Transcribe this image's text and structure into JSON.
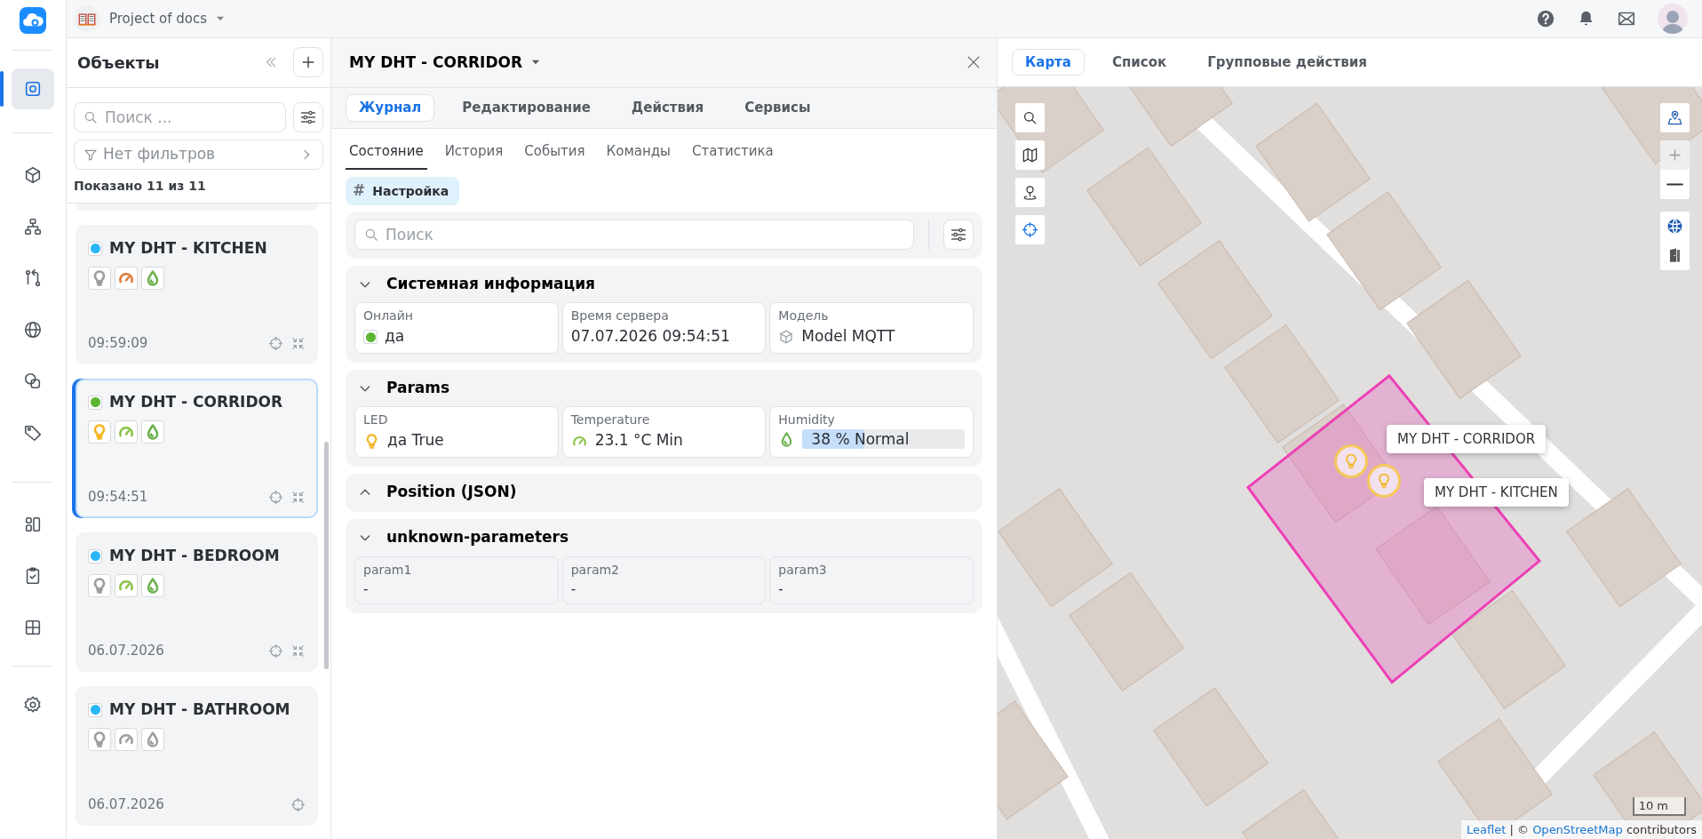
{
  "rail": {
    "groups": [
      [
        {
          "kind": "objects",
          "selected": true
        }
      ],
      [
        {
          "kind": "cube",
          "selected": false
        },
        {
          "kind": "hierarchy",
          "selected": false
        },
        {
          "kind": "compare",
          "selected": false
        },
        {
          "kind": "globe",
          "selected": false
        },
        {
          "kind": "shapes",
          "selected": false
        },
        {
          "kind": "tag",
          "selected": false
        }
      ],
      [
        {
          "kind": "dashboard",
          "selected": false
        },
        {
          "kind": "clipboard",
          "selected": false
        },
        {
          "kind": "grid",
          "selected": false
        }
      ],
      [
        {
          "kind": "gear",
          "selected": false
        }
      ]
    ]
  },
  "topbar": {
    "project": "Project of docs"
  },
  "objects": {
    "title": "Объекты",
    "search_placeholder": "Поиск ...",
    "filter": "Нет фильтров",
    "shown": "Показано 11 из 11",
    "cards": [
      {
        "name": "MY DHT - KITCHEN",
        "color": "#29b6f6",
        "selected": false,
        "time": "09:59:09",
        "fit_button": true,
        "icons": [
          {
            "kind": "bulb",
            "color": "#9e9e9e"
          },
          {
            "kind": "gauge",
            "color": "#e07b39"
          },
          {
            "kind": "drop",
            "color": "#6ab04c"
          }
        ]
      },
      {
        "name": "MY DHT - CORRIDOR",
        "color": "#5cb531",
        "selected": true,
        "time": "09:54:51",
        "fit_button": true,
        "icons": [
          {
            "kind": "bulb",
            "color": "#f2b824"
          },
          {
            "kind": "gauge",
            "color": "#8bc34a"
          },
          {
            "kind": "drop",
            "color": "#6ab04c"
          }
        ]
      },
      {
        "name": "MY DHT - BEDROOM",
        "color": "#29b6f6",
        "selected": false,
        "time": "06.07.2026",
        "fit_button": true,
        "icons": [
          {
            "kind": "bulb",
            "color": "#9e9e9e"
          },
          {
            "kind": "gauge",
            "color": "#8bc34a"
          },
          {
            "kind": "drop",
            "color": "#6ab04c"
          }
        ]
      },
      {
        "name": "MY DHT - BATHROOM",
        "color": "#29b6f6",
        "selected": false,
        "time": "06.07.2026",
        "fit_button": false,
        "icons": [
          {
            "kind": "bulb",
            "color": "#9e9e9e"
          },
          {
            "kind": "gauge",
            "color": "#9e9e9e"
          },
          {
            "kind": "drop",
            "color": "#9e9e9e"
          }
        ]
      }
    ]
  },
  "detail": {
    "title": "MY DHT - CORRIDOR",
    "tabs": [
      {
        "label": "Журнал",
        "selected": true
      },
      {
        "label": "Редактирование",
        "selected": false
      },
      {
        "label": "Действия",
        "selected": false
      },
      {
        "label": "Сервисы",
        "selected": false
      }
    ],
    "subtabs": [
      {
        "label": "Состояние",
        "selected": true
      },
      {
        "label": "История",
        "selected": false
      },
      {
        "label": "События",
        "selected": false
      },
      {
        "label": "Команды",
        "selected": false
      },
      {
        "label": "Статистика",
        "selected": false
      }
    ],
    "chip": {
      "symbol": "#",
      "label": "Настройка"
    },
    "search_placeholder": "Поиск",
    "sections": [
      {
        "title": "Системная информация",
        "expanded": true,
        "fields": [
          {
            "label": "Онлайн",
            "value": "да",
            "kind": "status",
            "color": "#5cb531"
          },
          {
            "label": "Время сервера",
            "value": "07.07.2026 09:54:51",
            "kind": "text"
          },
          {
            "label": "Модель",
            "value": "Model MQTT",
            "kind": "model"
          }
        ]
      },
      {
        "title": "Params",
        "expanded": true,
        "fields": [
          {
            "label": "LED",
            "value": "да True",
            "kind": "bulb",
            "color": "#f2b824"
          },
          {
            "label": "Temperature",
            "value": "23.1 °C Min",
            "kind": "gauge",
            "color": "#8bc34a"
          },
          {
            "label": "Humidity",
            "value": "38 % Normal",
            "kind": "meter",
            "color": "#6ab04c",
            "level": 0.38
          }
        ]
      },
      {
        "title": "Position (JSON)",
        "expanded": false
      },
      {
        "title": "unknown-parameters",
        "expanded": true,
        "fields": [
          {
            "label": "param1",
            "value": "-",
            "kind": "empty"
          },
          {
            "label": "param2",
            "value": "-",
            "kind": "empty"
          },
          {
            "label": "param3",
            "value": "-",
            "kind": "empty"
          }
        ]
      }
    ]
  },
  "map": {
    "tabs": [
      {
        "label": "Карта",
        "selected": true
      },
      {
        "label": "Список",
        "selected": false
      },
      {
        "label": "Групповые действия",
        "selected": false
      }
    ],
    "tooltips": [
      "MY DHT - CORRIDOR",
      "MY DHT - KITCHEN"
    ],
    "scale": "10 m",
    "attribution": {
      "link1": "Leaflet",
      "sep": "| ©",
      "link2": "OpenStreetMap",
      "rest": "contributors"
    }
  }
}
